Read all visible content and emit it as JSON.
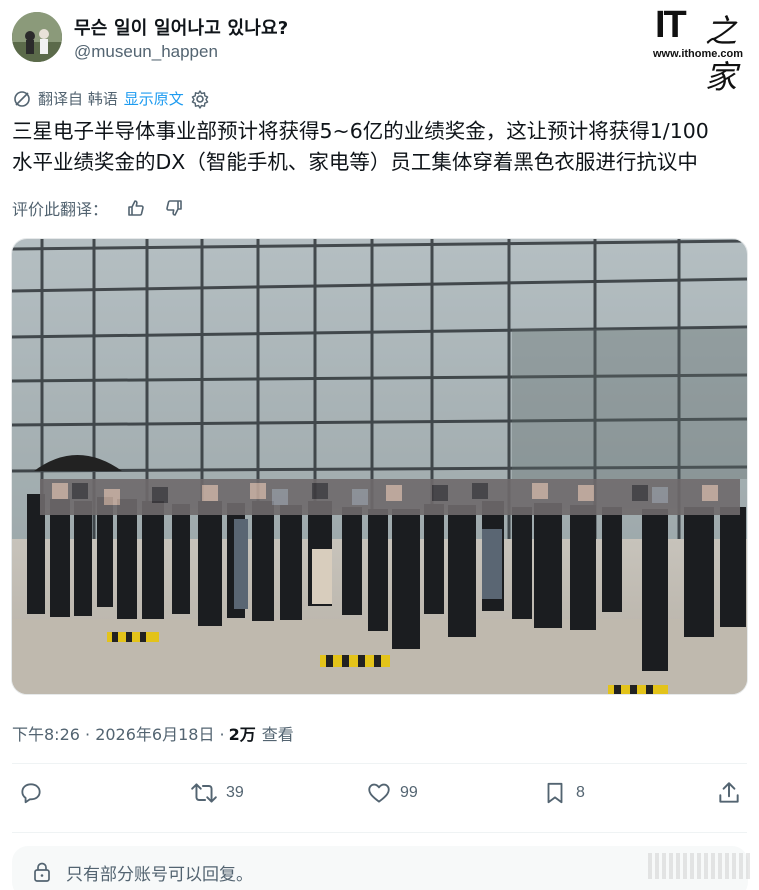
{
  "author": {
    "display_name": "무슨 일이 일어나고 있나요?",
    "handle": "@museun_happen"
  },
  "watermark_logo": {
    "brand": "IT之家",
    "it_text": "IT",
    "url": "www.ithome.com"
  },
  "translation": {
    "label": "翻译自 韩语",
    "show_original": "显示原文"
  },
  "tweet": {
    "text_line1": "三星电子半导体事业部预计将获得5~6亿的业绩奖金，这让预计将获得1/100",
    "text_line2": "水平业绩奖金的DX（智能手机、家电等）员工集体穿着黑色衣服进行抗议中"
  },
  "rate": {
    "label": "评价此翻译："
  },
  "meta": {
    "timestamp": "下午8:26 · 2026年6月18日 · ",
    "views_count": "2万",
    "views_label": "查看"
  },
  "actions": {
    "reply_count": "",
    "retweet_count": "39",
    "like_count": "99",
    "bookmark_count": "8"
  },
  "reply_notice": {
    "text": "只有部分账号可以回复。"
  },
  "colors": {
    "accent": "#1d9bf0",
    "secondary_text": "#536471",
    "primary_text": "#0f1419"
  }
}
